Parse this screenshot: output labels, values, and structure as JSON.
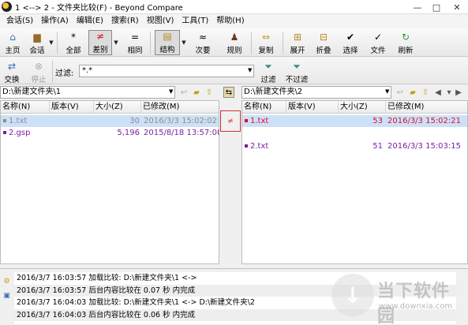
{
  "window": {
    "title": "1 <--> 2 - 文件夹比较(F) - Beyond Compare"
  },
  "menu": [
    "会话(S)",
    "操作(A)",
    "编辑(E)",
    "搜索(R)",
    "视图(V)",
    "工具(T)",
    "帮助(H)"
  ],
  "toolbar": {
    "home": "主页",
    "session": "会话",
    "all": "全部",
    "diffs": "差别",
    "same": "相同",
    "structure": "结构",
    "minor": "次要",
    "rules": "规则",
    "copy": "复制",
    "expand": "展开",
    "collapse": "折叠",
    "select": "选择",
    "files": "文件",
    "refresh": "刷新"
  },
  "toolbar2": {
    "swap": "交换",
    "stop": "停止",
    "filter_label": "过滤:",
    "filter_value": "*.*",
    "filter_btn": "过滤",
    "nofilter_btn": "不过滤"
  },
  "left": {
    "path": "D:\\新建文件夹\\1",
    "columns": [
      "名称(N)",
      "版本(V)",
      "大小(Z)",
      "已修改(M)"
    ],
    "rows": [
      {
        "name": "1.txt",
        "version": "",
        "size": "30",
        "modified": "2016/3/3 15:02:02"
      },
      {
        "name": "2.gsp",
        "version": "",
        "size": "5,196",
        "modified": "2015/8/18 13:57:00"
      }
    ]
  },
  "right": {
    "path": "D:\\新建文件夹\\2",
    "columns": [
      "名称(N)",
      "版本(V)",
      "大小(Z)",
      "已修改(M)"
    ],
    "rows": [
      {
        "name": "1.txt",
        "version": "",
        "size": "53",
        "modified": "2016/3/3 15:02:21"
      },
      {
        "name": "2.txt",
        "version": "",
        "size": "51",
        "modified": "2016/3/3 15:03:15"
      }
    ]
  },
  "log": [
    "2016/3/7 16:03:57  加载比较: D:\\新建文件夹\\1 <->",
    "2016/3/7 16:03:57  后台内容比较在 0.07 秒 内完成",
    "2016/3/7 16:04:03  加载比较: D:\\新建文件夹\\1 <-> D:\\新建文件夹\\2",
    "2016/3/7 16:04:03  后台内容比较在 0.06 秒 内完成"
  ],
  "watermark": {
    "title": "当下软件园",
    "url": "www.downxia.com"
  },
  "colors": {
    "selected_row": "#cde0f7",
    "diff_red": "#d8102a",
    "orphan_purple": "#7b1fa2",
    "same_gray": "#8c8c8c"
  }
}
